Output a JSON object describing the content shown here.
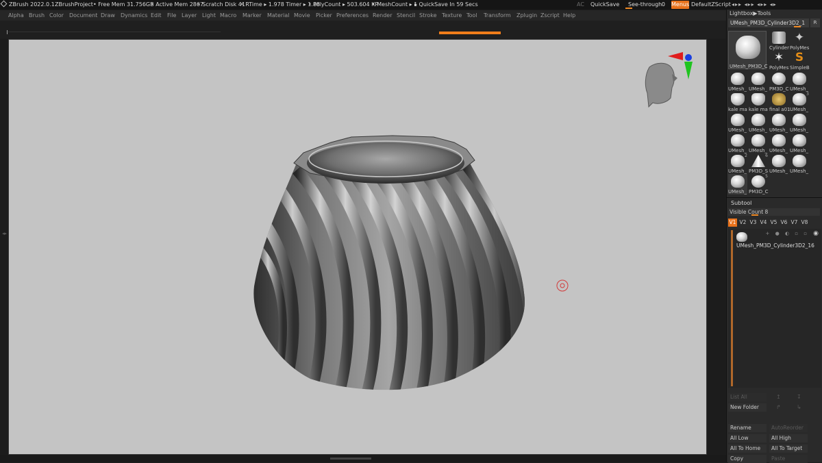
{
  "titlebar": {
    "app_version": "ZBrush 2022.0.1",
    "project": "ZBrushProject",
    "free_mem": "• Free Mem 31.756GB",
    "active_mem": "• Active Mem 2867",
    "scratch_disk": "• Scratch Disk 41",
    "rtime": "• RTime ▸ 1.978 Timer ▸ 1.88",
    "polycount": "• PolyCount ▸ 503.604 KP",
    "meshcount": "• MeshCount ▸ 1",
    "quicksave_in": "▸ QuickSave In 59 Secs",
    "ac": "AC",
    "quicksave": "QuickSave",
    "see_through_label": "See-through",
    "see_through_value": "0",
    "menus": "Menus",
    "default_zscript": "DefaultZScript"
  },
  "menubar": [
    "Alpha",
    "Brush",
    "Color",
    "Document",
    "Draw",
    "Dynamics",
    "Edit",
    "File",
    "Layer",
    "Light",
    "Macro",
    "Marker",
    "Material",
    "Movie",
    "Picker",
    "Preferences",
    "Render",
    "Stencil",
    "Stroke",
    "Texture",
    "Tool",
    "Transform",
    "Zplugin",
    "Zscript",
    "Help"
  ],
  "rightpanel": {
    "lightbox_tools": "Lightbox▶Tools",
    "tool_name": "UMesh_PM3D_Cylinder3D2_1",
    "tool_r": "R",
    "big_thumb_label": "UMesh_PM3D_C",
    "thumbs_top": [
      {
        "label": "Cylinder",
        "icon": "cylinder-icon"
      },
      {
        "label": "PolyMes",
        "icon": "star-icon"
      },
      {
        "label": "PolyMes",
        "icon": "star-icon"
      },
      {
        "label": "SimpleB",
        "icon": "simplebrush-icon"
      }
    ],
    "thumb_grid": [
      "UMesh_",
      "UMesh_",
      "PM3D_C",
      "UMesh_",
      "kale ma",
      "kale ma",
      "final a01",
      "UMesh_",
      "UMesh_",
      "UMesh_",
      "UMesh_",
      "UMesh_",
      "UMesh_",
      "UMesh_",
      "UMesh_",
      "UMesh_",
      "UMesh_",
      "PM3D_S",
      "UMesh_",
      "UMesh_",
      "UMesh_",
      "PM3D_C"
    ],
    "thumb_numbers": {
      "r4c3": "3",
      "r5c0": "2",
      "r5c1": "6",
      "r6c1": "5"
    },
    "subtool_title": "Subtool",
    "visible_count": "Visible Count 8",
    "v_buttons": [
      "V1",
      "V2",
      "V3",
      "V4",
      "V5",
      "V6",
      "V7",
      "V8"
    ],
    "subtool_item": "UMesh_PM3D_Cylinder3D2_16",
    "list_all": "List All",
    "new_folder": "New Folder",
    "rename": "Rename",
    "auto_reorder": "AutoReorder",
    "all_low": "All Low",
    "all_high": "All High",
    "all_to_home": "All To Home",
    "all_to_target": "All To Target",
    "copy": "Copy",
    "paste": "Paste"
  }
}
